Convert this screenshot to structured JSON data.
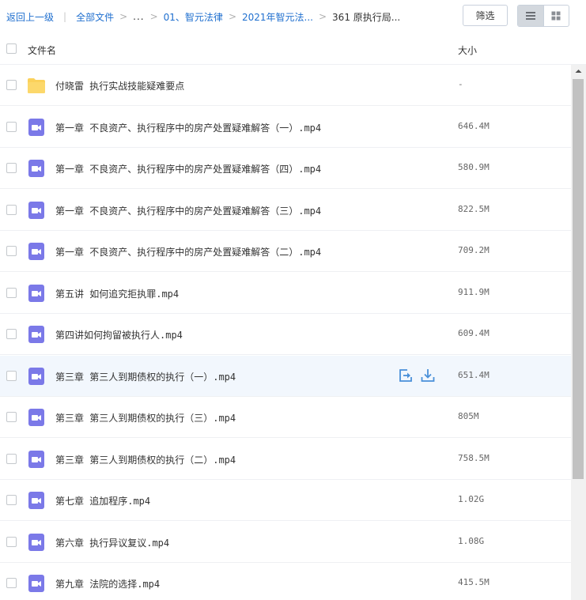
{
  "breadcrumb": {
    "back_label": "返回上一级",
    "all_files_label": "全部文件",
    "ellipsis": "...",
    "path": [
      "01、智元法律",
      "2021年智元法..."
    ],
    "current": "361 原执行局..."
  },
  "toolbar": {
    "filter_label": "筛选",
    "view_mode": "list"
  },
  "table": {
    "header_name": "文件名",
    "header_size": "大小"
  },
  "files": [
    {
      "name": "付晓雷 执行实战技能疑难要点",
      "size": "-",
      "type": "folder"
    },
    {
      "name": "第一章 不良资产、执行程序中的房产处置疑难解答（一）.mp4",
      "size": "646.4M",
      "type": "video"
    },
    {
      "name": "第一章 不良资产、执行程序中的房产处置疑难解答（四）.mp4",
      "size": "580.9M",
      "type": "video"
    },
    {
      "name": "第一章 不良资产、执行程序中的房产处置疑难解答（三）.mp4",
      "size": "822.5M",
      "type": "video"
    },
    {
      "name": "第一章 不良资产、执行程序中的房产处置疑难解答（二）.mp4",
      "size": "709.2M",
      "type": "video"
    },
    {
      "name": "第五讲 如何追究拒执罪.mp4",
      "size": "911.9M",
      "type": "video"
    },
    {
      "name": "第四讲如何拘留被执行人.mp4",
      "size": "609.4M",
      "type": "video"
    },
    {
      "name": "第三章 第三人到期债权的执行（一）.mp4",
      "size": "651.4M",
      "type": "video",
      "hovered": true
    },
    {
      "name": "第三章 第三人到期债权的执行（三）.mp4",
      "size": "805M",
      "type": "video"
    },
    {
      "name": "第三章 第三人到期债权的执行（二）.mp4",
      "size": "758.5M",
      "type": "video"
    },
    {
      "name": "第七章 追加程序.mp4",
      "size": "1.02G",
      "type": "video"
    },
    {
      "name": "第六章 执行异议复议.mp4",
      "size": "1.08G",
      "type": "video"
    },
    {
      "name": "第九章 法院的选择.mp4",
      "size": "415.5M",
      "type": "video"
    }
  ],
  "row_actions": [
    {
      "icon": "share-icon"
    },
    {
      "icon": "download-icon"
    }
  ],
  "colors": {
    "accent": "#1f6fcf",
    "video_icon": "#7b79e8",
    "folder_icon": "#fbd15a",
    "action_icon": "#4a90d9",
    "hover_row": "#f2f7fd"
  }
}
